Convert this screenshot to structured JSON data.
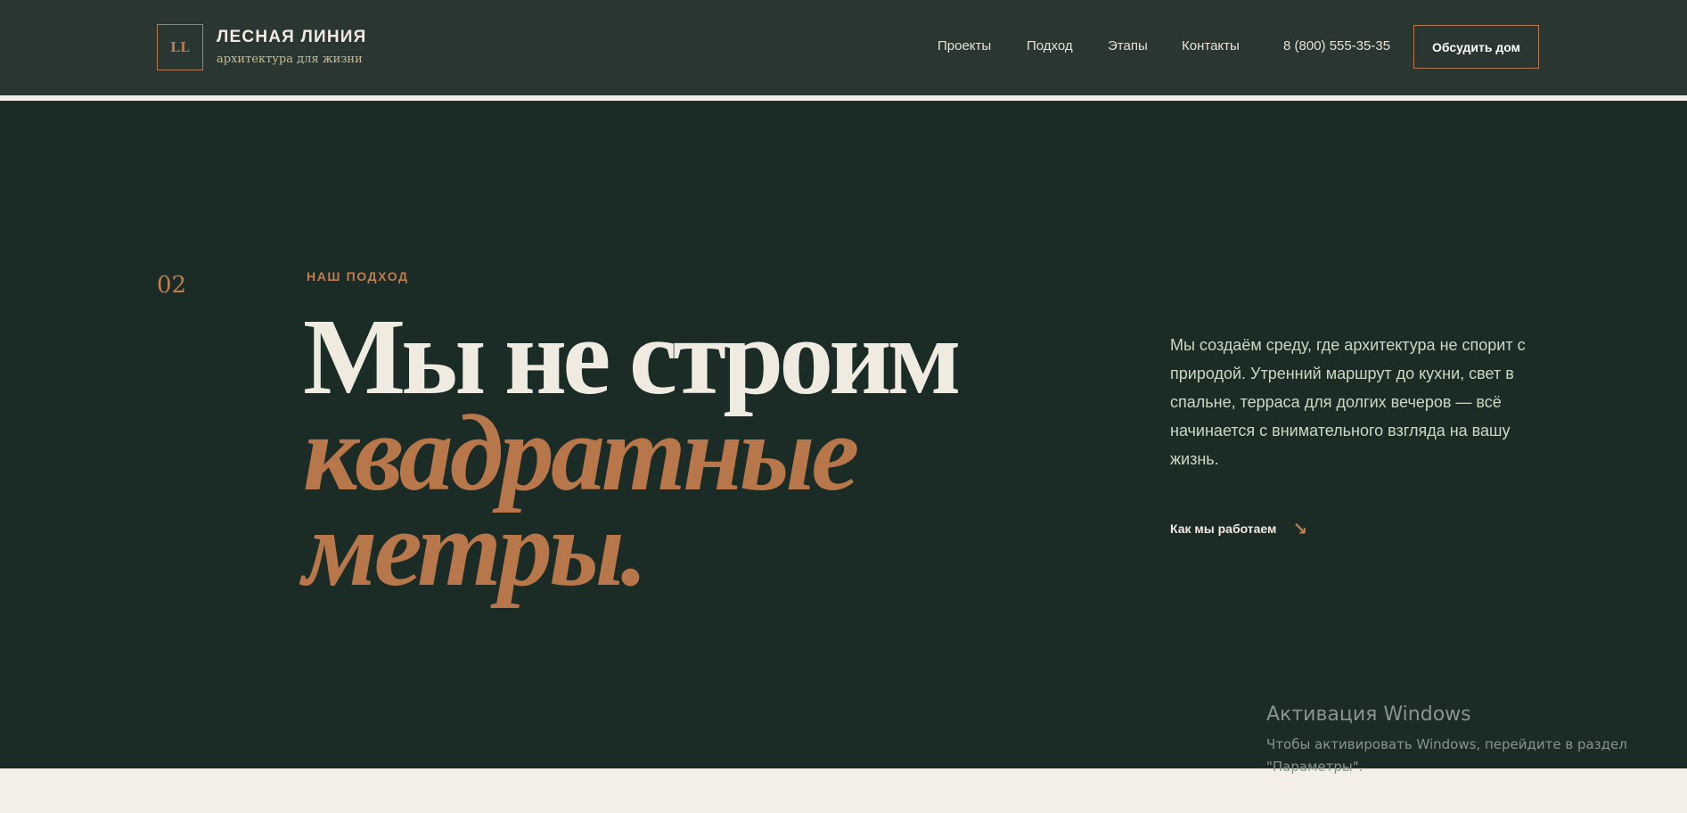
{
  "header": {
    "logo_monogram": "LL",
    "brand_name": "ЛЕСНАЯ ЛИНИЯ",
    "brand_tagline": "архитектура для жизни",
    "nav": [
      {
        "label": "Проекты"
      },
      {
        "label": "Подход"
      },
      {
        "label": "Этапы"
      },
      {
        "label": "Контакты"
      }
    ],
    "phone": "8 (800) 555-35-35",
    "cta_label": "Обсудить дом"
  },
  "hero": {
    "section_number": "02",
    "eyebrow": "НАШ ПОДХОД",
    "headline": {
      "line1": "Мы не строим",
      "line2": "квадратные",
      "line3": "метры."
    },
    "description": "Мы создаём среду, где архитектура не спорит с природой. Утренний маршрут до кухни, свет в спальне, терраса для долгих вечеров — всё начинается с внимательного взгляда на вашу жизнь.",
    "link_label": "Как мы работаем",
    "link_icon": "↘"
  },
  "watermark": {
    "title": "Активация Windows",
    "subtitle": "Чтобы активировать Windows, перейдите в раздел \"Параметры\"."
  },
  "colors": {
    "header_bg": "#2a3632",
    "hero_bg": "#1b2b25",
    "accent": "#b8764b",
    "light_text": "#f0ebe0",
    "page_bg": "#f4efe6"
  }
}
